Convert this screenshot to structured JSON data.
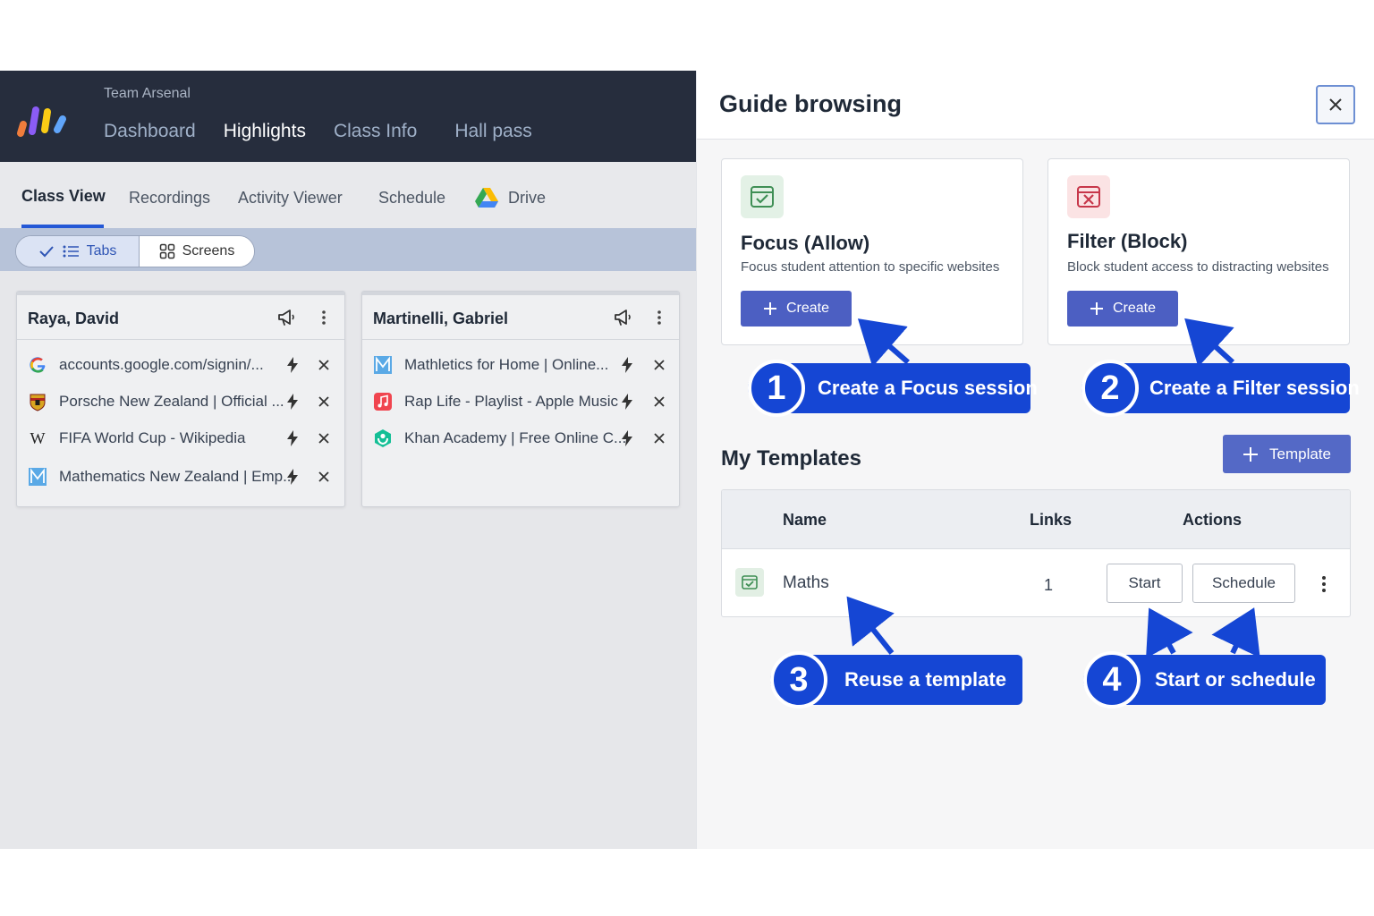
{
  "app": {
    "team_name": "Team Arsenal",
    "top_nav": [
      "Dashboard",
      "Highlights",
      "Class Info",
      "Hall pass"
    ],
    "top_nav_active": "Highlights",
    "sub_nav": [
      "Class View",
      "Recordings",
      "Activity Viewer",
      "Schedule",
      "Drive"
    ],
    "sub_nav_active": "Class View",
    "view_toggle": {
      "tabs_label": "Tabs",
      "screens_label": "Screens",
      "selected": "Tabs"
    },
    "students": [
      {
        "name": "Raya, David",
        "tabs": [
          {
            "title": "accounts.google.com/signin/...",
            "icon": "google-icon"
          },
          {
            "title": "Porsche New Zealand | Official ...",
            "icon": "porsche-icon"
          },
          {
            "title": "FIFA World Cup - Wikipedia",
            "icon": "wikipedia-icon"
          },
          {
            "title": "Mathematics New Zealand | Emp...",
            "icon": "mathletics-icon"
          }
        ]
      },
      {
        "name": "Martinelli, Gabriel",
        "tabs": [
          {
            "title": "Mathletics for Home | Online...",
            "icon": "mathletics-icon"
          },
          {
            "title": "Rap Life - Playlist - Apple Music",
            "icon": "apple-music-icon"
          },
          {
            "title": "Khan Academy | Free Online C...",
            "icon": "khan-academy-icon"
          }
        ]
      }
    ]
  },
  "panel": {
    "title": "Guide browsing",
    "focus": {
      "title": "Focus (Allow)",
      "description": "Focus student attention to specific websites",
      "button": "Create"
    },
    "filter": {
      "title": "Filter (Block)",
      "description": "Block student access to distracting websites",
      "button": "Create"
    },
    "templates_title": "My Templates",
    "template_button": "Template",
    "table": {
      "headers": [
        "Name",
        "Links",
        "Actions"
      ],
      "rows": [
        {
          "name": "Maths",
          "links": "1",
          "start": "Start",
          "schedule": "Schedule"
        }
      ]
    }
  },
  "callouts": [
    {
      "number": "1",
      "text": "Create a Focus session"
    },
    {
      "number": "2",
      "text": "Create a Filter session"
    },
    {
      "number": "3",
      "text": "Reuse a template"
    },
    {
      "number": "4",
      "text": "Start or schedule"
    }
  ],
  "colors": {
    "topbar": "#262d3d",
    "accent_button": "#4c5fc2",
    "callout_blue": "#1546d4",
    "focus_green": "#3f8f55",
    "filter_red": "#c7374a"
  }
}
